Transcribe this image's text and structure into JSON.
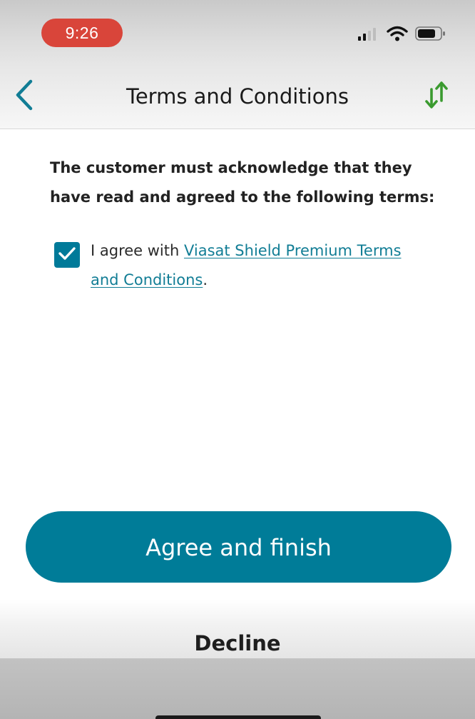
{
  "status_bar": {
    "time": "9:26",
    "icons": [
      "cellular-signal-icon",
      "wifi-icon",
      "battery-icon"
    ]
  },
  "nav": {
    "title": "Terms and Conditions",
    "back_icon": "chevron-left-icon",
    "action_icon": "sort-arrows-icon"
  },
  "content": {
    "intro": "The customer must acknowledge that they have read and agreed to the following terms:",
    "agree_prefix": "I agree with ",
    "terms_link": "Viasat Shield Premium Terms and Conditions",
    "agree_suffix": ".",
    "checkbox_checked": true
  },
  "actions": {
    "primary_label": "Agree and finish",
    "secondary_label": "Decline"
  },
  "colors": {
    "accent": "#007c98",
    "link": "#117d95",
    "green_arrow": "#3a9a2f",
    "time_pill": "#d9453a"
  }
}
